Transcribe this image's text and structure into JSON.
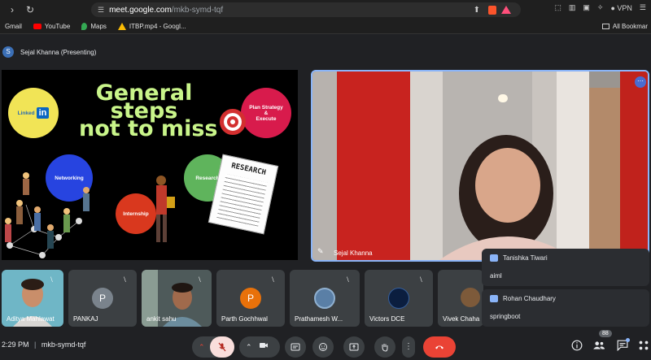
{
  "browser": {
    "url_host": "meet.google.com",
    "url_path": "/mkb-symd-tqf",
    "vpn_label": "VPN",
    "bookmarks": [
      "Gmail",
      "YouTube",
      "Maps",
      "ITBP.mp4 - Googl..."
    ],
    "all_bookmarks": "All Bookmar"
  },
  "presenting": {
    "avatar_letter": "S",
    "label": "Sejal Khanna (Presenting)"
  },
  "slide": {
    "title_line1": "General",
    "title_line2": "steps",
    "title_line3": "not to miss",
    "linkedin_text": "Linked",
    "linkedin_logo": "in",
    "plan_strategy": "Plan Strategy",
    "amp": "&",
    "execute": "Execute",
    "networking": "Networking",
    "research": "Research",
    "internship": "Internship",
    "research_doc": "RESEARCH"
  },
  "speaker": {
    "name": "Sejal Khanna"
  },
  "tiles": [
    {
      "name": "Aditya Mahlawat",
      "type": "video"
    },
    {
      "name": "PANKAJ",
      "letter": "P",
      "color": "#7a838c"
    },
    {
      "name": "ankit sahu",
      "type": "video"
    },
    {
      "name": "Parth Gochhwal",
      "letter": "P",
      "color": "#e8710a"
    },
    {
      "name": "Prathamesh W...",
      "type": "photo"
    },
    {
      "name": "Victors DCE",
      "type": "logo"
    },
    {
      "name": "Vivek Chaha",
      "type": "photo"
    }
  ],
  "chat": [
    {
      "name": "Tanishka Tiwari",
      "message": "aiml"
    },
    {
      "name": "Rohan Chaudhary",
      "message": "springboot"
    }
  ],
  "bottom": {
    "time": "2:29 PM",
    "separator": "|",
    "meeting_code": "mkb-symd-tqf",
    "participant_count": "88"
  },
  "colors": {
    "accent_blue": "#8ab4f8",
    "end_call_red": "#ea4335",
    "mic_off_bg": "#f9dedc",
    "slide_title_green": "#c9f58a"
  }
}
